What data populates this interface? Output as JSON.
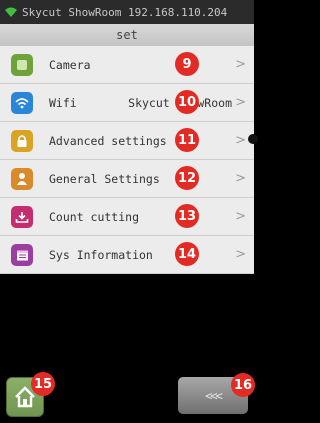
{
  "status_bar": {
    "text": "Skycut ShowRoom 192.168.110.204"
  },
  "header": {
    "title": "set"
  },
  "menu": {
    "items": [
      {
        "label": "Camera",
        "value": "",
        "icon": "camera-icon",
        "color": "#6fa33a",
        "badge": "9"
      },
      {
        "label": "Wifi",
        "value": "Skycut ShowRoom",
        "icon": "wifi-icon",
        "color": "#2a86d6",
        "badge": "10"
      },
      {
        "label": "Advanced settings",
        "value": "",
        "icon": "lock-icon",
        "color": "#d9a424",
        "badge": "11"
      },
      {
        "label": "General Settings",
        "value": "",
        "icon": "user-icon",
        "color": "#d98a2a",
        "badge": "12"
      },
      {
        "label": "Count cutting",
        "value": "",
        "icon": "download-icon",
        "color": "#c42e70",
        "badge": "13"
      },
      {
        "label": "Sys Information",
        "value": "",
        "icon": "calendar-icon",
        "color": "#9a3fa0",
        "badge": "14"
      }
    ],
    "chevron": ">"
  },
  "bottom": {
    "home_badge": "15",
    "back_badge": "16",
    "home_icon": "home-icon",
    "back_icon": "back-arrows-icon",
    "back_arrows": "<<<"
  },
  "colors": {
    "badge": "#e32b25",
    "status_bg": "#2b2b2b",
    "home_btn": "#7fa45d"
  }
}
